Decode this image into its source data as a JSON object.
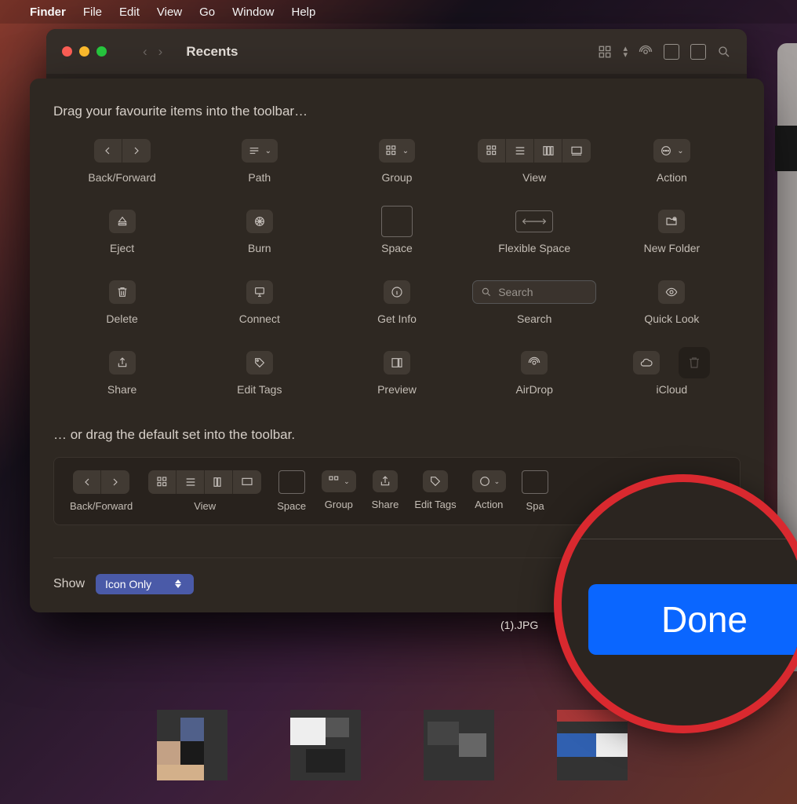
{
  "menubar": {
    "app": "Finder",
    "items": [
      "File",
      "Edit",
      "View",
      "Go",
      "Window",
      "Help"
    ]
  },
  "window": {
    "title": "Recents"
  },
  "sheet": {
    "heading": "Drag your favourite items into the toolbar…",
    "row1": [
      {
        "id": "back-forward",
        "label": "Back/Forward"
      },
      {
        "id": "path",
        "label": "Path"
      },
      {
        "id": "group",
        "label": "Group"
      },
      {
        "id": "view",
        "label": "View"
      },
      {
        "id": "action",
        "label": "Action"
      }
    ],
    "row2": [
      {
        "id": "eject",
        "label": "Eject"
      },
      {
        "id": "burn",
        "label": "Burn"
      },
      {
        "id": "space",
        "label": "Space"
      },
      {
        "id": "flexspace",
        "label": "Flexible Space"
      },
      {
        "id": "newfolder",
        "label": "New Folder"
      }
    ],
    "row3": [
      {
        "id": "delete",
        "label": "Delete"
      },
      {
        "id": "connect",
        "label": "Connect"
      },
      {
        "id": "getinfo",
        "label": "Get Info"
      },
      {
        "id": "search",
        "label": "Search",
        "placeholder": "Search"
      },
      {
        "id": "quicklook",
        "label": "Quick Look"
      }
    ],
    "row4": [
      {
        "id": "share",
        "label": "Share"
      },
      {
        "id": "edittags",
        "label": "Edit Tags"
      },
      {
        "id": "preview",
        "label": "Preview"
      },
      {
        "id": "airdrop",
        "label": "AirDrop"
      },
      {
        "id": "icloud",
        "label": "iCloud"
      }
    ],
    "sub": "… or drag the default set into the toolbar.",
    "defaults": [
      {
        "id": "back-forward",
        "label": "Back/Forward"
      },
      {
        "id": "view",
        "label": "View"
      },
      {
        "id": "space",
        "label": "Space"
      },
      {
        "id": "group",
        "label": "Group"
      },
      {
        "id": "share",
        "label": "Share"
      },
      {
        "id": "edittags",
        "label": "Edit Tags"
      },
      {
        "id": "action",
        "label": "Action"
      },
      {
        "id": "space2",
        "label": "Spa"
      }
    ],
    "footer": {
      "show_label": "Show",
      "select_value": "Icon Only",
      "done": "Done"
    }
  },
  "zoom": {
    "button": "Done"
  },
  "thumbs": {
    "caption": "(1).JPG"
  }
}
